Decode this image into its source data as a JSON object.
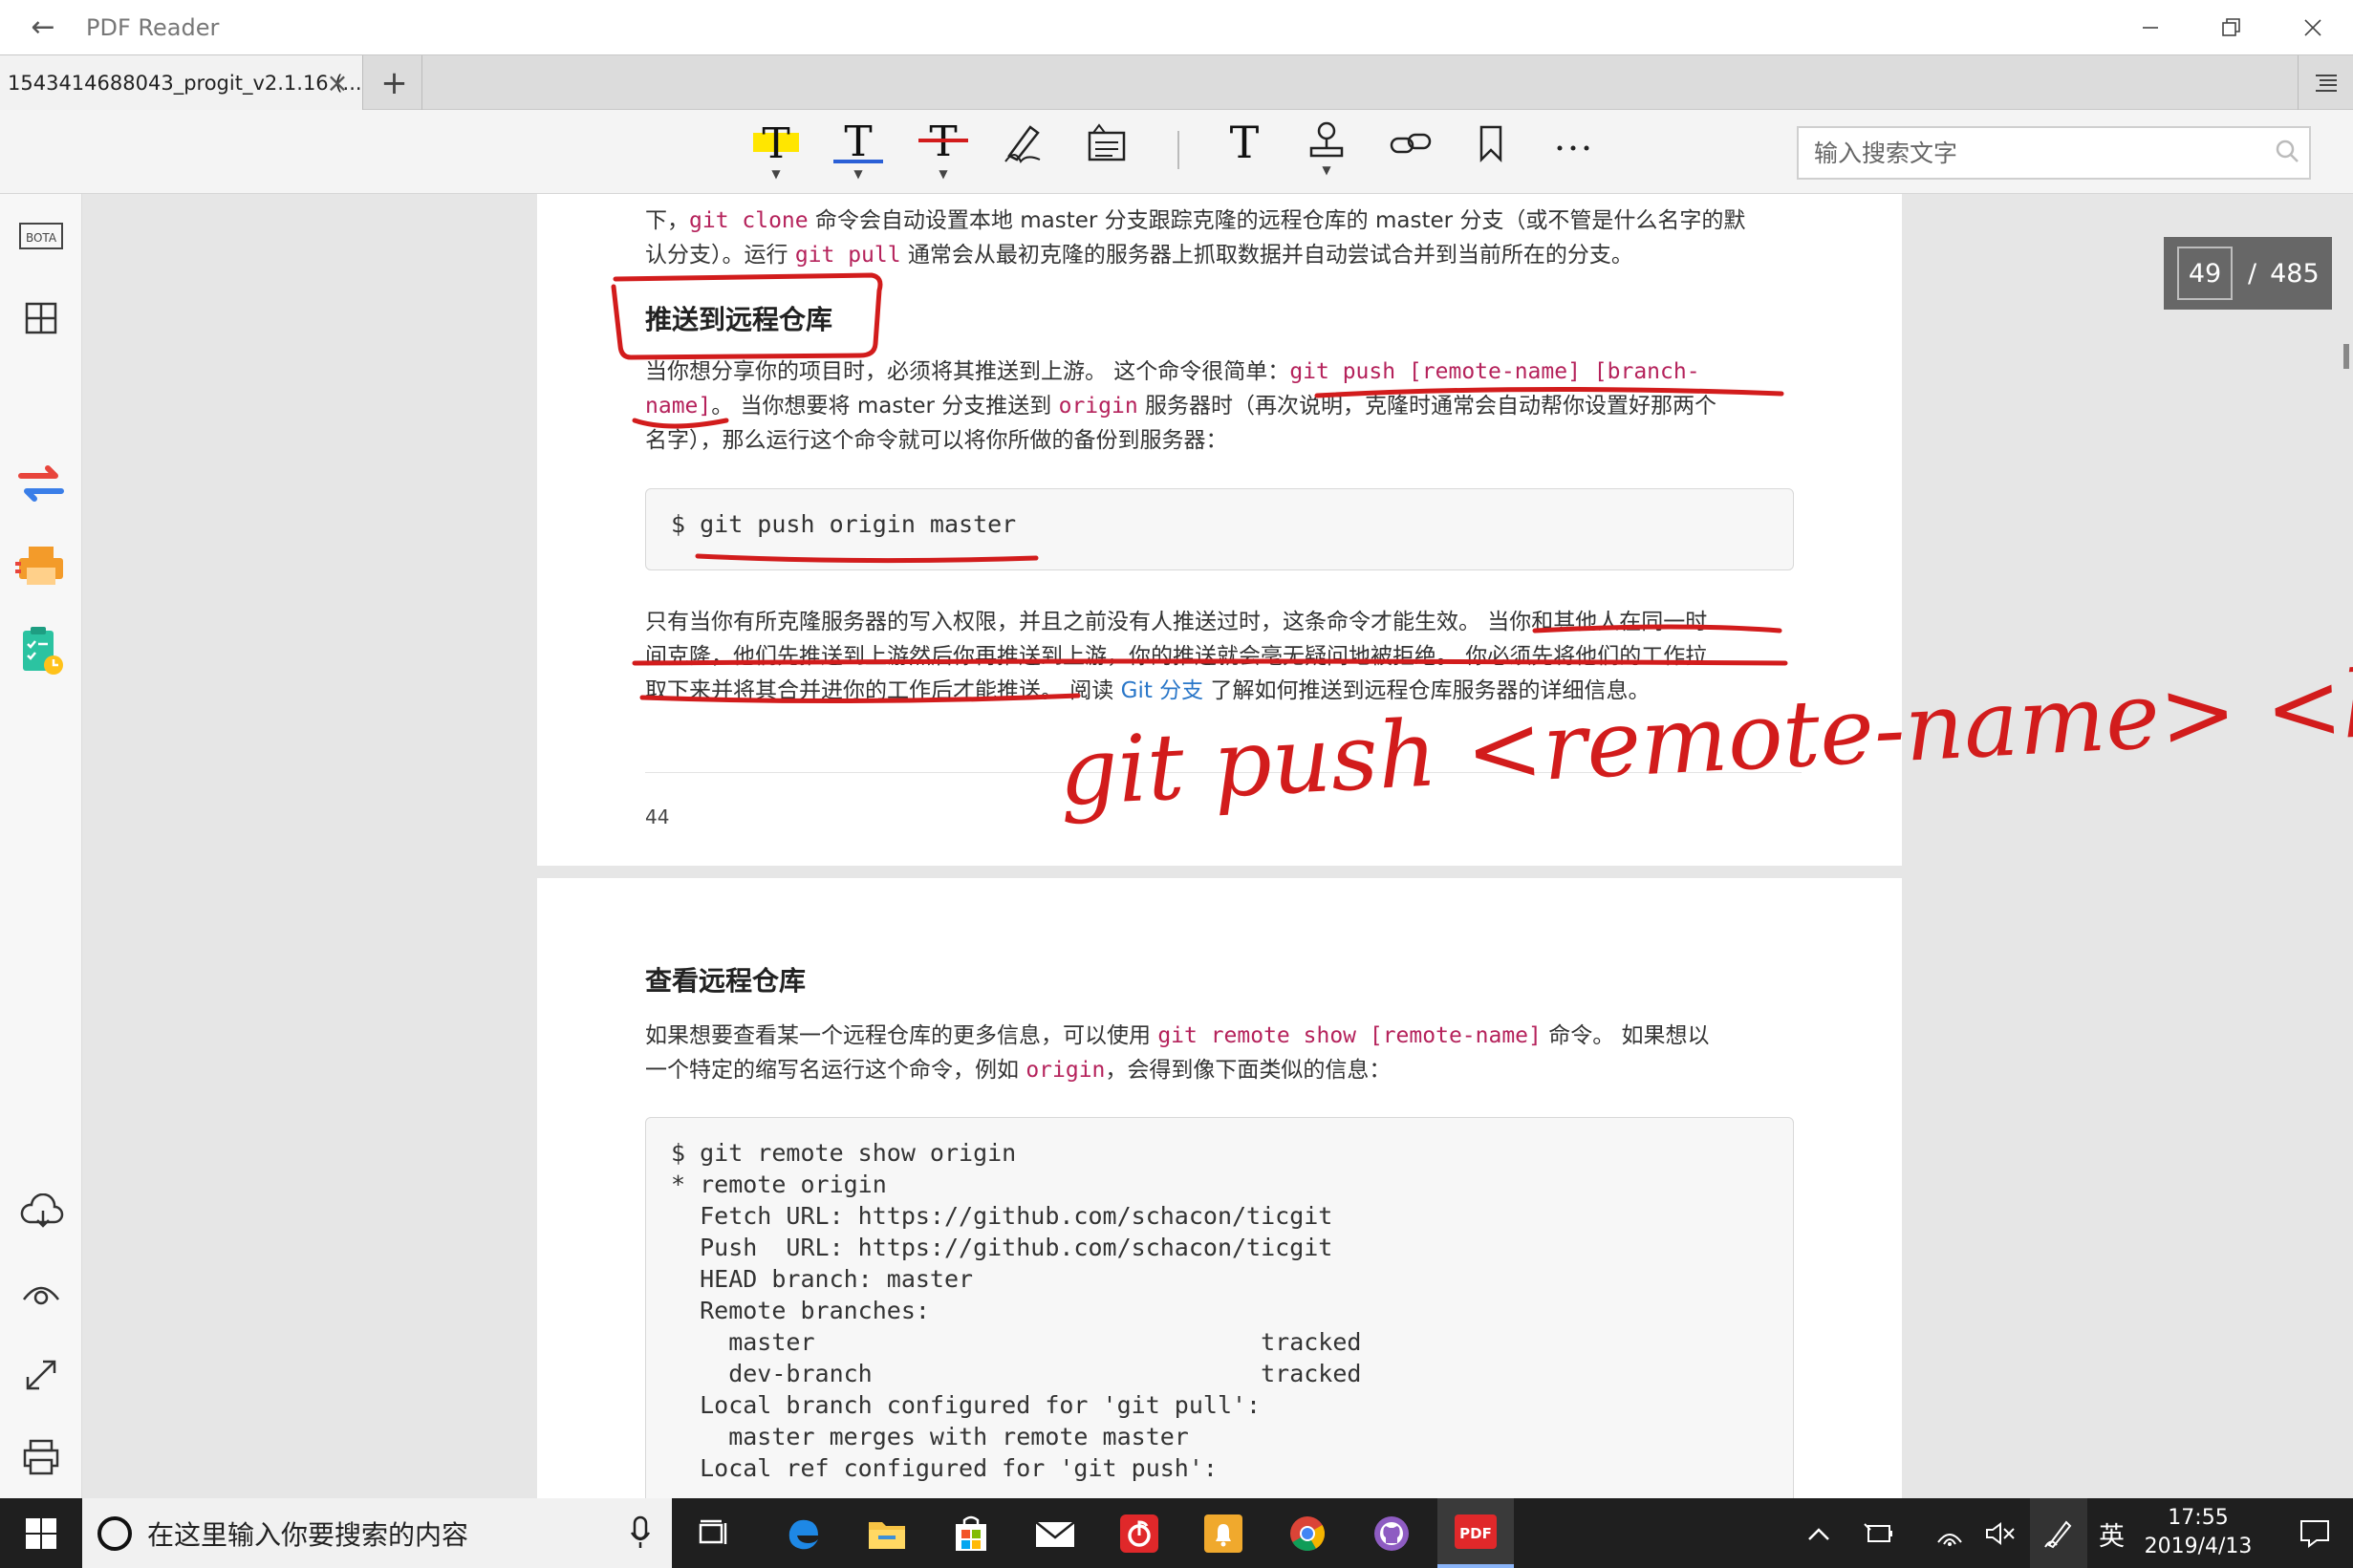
{
  "app": {
    "title": "PDF Reader"
  },
  "tabs": [
    {
      "label": "1543414688043_progit_v2.1.16 (..."
    }
  ],
  "search": {
    "placeholder": "输入搜索文字"
  },
  "page_counter": {
    "current": "49",
    "separator": "/",
    "total": "485"
  },
  "sidebar": {
    "bota_label": "BOTA"
  },
  "colors": {
    "accent_red": "#d21c1c",
    "code_red": "#b5225b",
    "link_blue": "#2a77c9",
    "highlight_yellow": "#ffe600"
  },
  "page1": {
    "line1_pre": "下，",
    "line1_code1": "git clone",
    "line1_post": " 命令会自动设置本地 master 分支跟踪克隆的远程仓库的 master 分支（或不管是什么名字的默",
    "line2_pre": "认分支）。运行 ",
    "line2_code": "git pull",
    "line2_post": " 通常会从最初克隆的服务器上抓取数据并自动尝试合并到当前所在的分支。",
    "heading": "推送到远程仓库",
    "p2_a": "当你想分享你的项目时，必须将其推送到上游。 这个命令很简单：",
    "p2_code1": "git push [remote-name] [branch-",
    "p2_code2": "name]",
    "p2_b": "。 当你想要将 master 分支推送到 ",
    "p2_code3": "origin",
    "p2_c": " 服务器时（再次说明，克隆时通常会自动帮你设置好那两个",
    "p2_d": "名字），那么运行这个命令就可以将你所做的备份到服务器：",
    "code_block": "$ git push origin master",
    "p3_l1": "只有当你有所克隆服务器的写入权限，并且之前没有人推送过时，这条命令才能生效。 当你和其他人在同一时",
    "p3_l2": "间克隆，他们先推送到上游然后你再推送到上游，你的推送就会毫无疑问地被拒绝。 你必须先将他们的工作拉",
    "p3_l3a": "取下来并将其合并进你的工作后才能推送。 阅读 ",
    "p3_link": "Git 分支",
    "p3_l3b": " 了解如何推送到远程仓库服务器的详细信息。",
    "page_number": "44"
  },
  "page2": {
    "heading": "查看远程仓库",
    "p1_a": "如果想要查看某一个远程仓库的更多信息，可以使用 ",
    "p1_code": "git remote show [remote-name]",
    "p1_b": " 命令。 如果想以",
    "p1_c": "一个特定的缩写名运行这个命令，例如 ",
    "p1_code2": "origin",
    "p1_d": "，会得到像下面类似的信息：",
    "code_block": "$ git remote show origin\n* remote origin\n  Fetch URL: https://github.com/schacon/ticgit\n  Push  URL: https://github.com/schacon/ticgit\n  HEAD branch: master\n  Remote branches:\n    master                               tracked\n    dev-branch                           tracked\n  Local branch configured for 'git pull':\n    master merges with remote master\n  Local ref configured for 'git push':"
  },
  "handwriting": {
    "text": "git push <remote-name> <branch>"
  },
  "taskbar": {
    "search_placeholder": "在这里输入你要搜索的内容",
    "ime": "英",
    "time": "17:55",
    "date": "2019/4/13"
  }
}
